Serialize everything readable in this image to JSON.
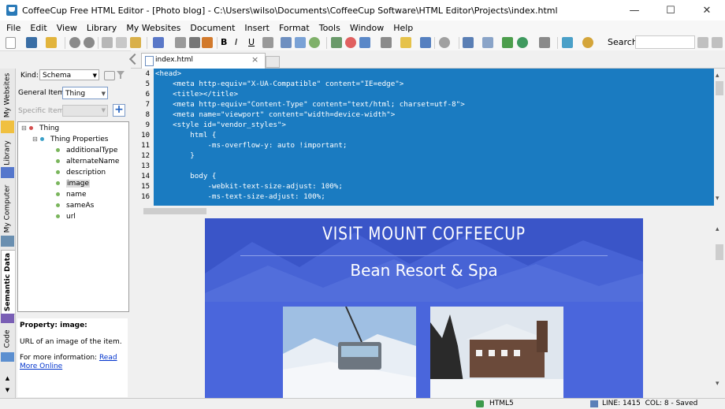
{
  "window": {
    "title": "CoffeeCup Free HTML Editor - [Photo blog] - C:\\Users\\wilso\\Documents\\CoffeeCup Software\\HTML Editor\\Projects\\index.html",
    "minimize": "—",
    "maximize": "☐",
    "close": "✕"
  },
  "menu": [
    "File",
    "Edit",
    "View",
    "Library",
    "My Websites",
    "Document",
    "Insert",
    "Format",
    "Tools",
    "Window",
    "Help"
  ],
  "toolbar": {
    "search_label": "Search:"
  },
  "sidebar_tabs": [
    "My Websites",
    "Library",
    "My Computer",
    "Semantic Data",
    "Code"
  ],
  "semantic": {
    "kind_label": "Kind:",
    "kind_value": "Schema",
    "general_label": "General Item:",
    "general_value": "Thing",
    "specific_label": "Specific Item:",
    "specific_value": "",
    "tree_root": "Thing",
    "tree_group": "Thing Properties",
    "properties": [
      "additionalType",
      "alternateName",
      "description",
      "image",
      "name",
      "sameAs",
      "url"
    ],
    "selected_property": "image",
    "desc_title": "Property: image:",
    "desc_body": "URL of an image of the item.",
    "desc_more": "For more information:",
    "desc_link": "Read More Online"
  },
  "editor": {
    "tab_label": "index.html",
    "tab_close": "×",
    "line_numbers": [
      "4",
      "5",
      "6",
      "7",
      "8",
      "9",
      "10",
      "11",
      "12",
      "13",
      "14",
      "15",
      "16"
    ],
    "lines": [
      "<head>",
      "    <meta http-equiv=\"X-UA-Compatible\" content=\"IE=edge\">",
      "    <title></title>",
      "    <meta http-equiv=\"Content-Type\" content=\"text/html; charset=utf-8\">",
      "    <meta name=\"viewport\" content=\"width=device-width\">",
      "    <style id=\"vendor_styles\">",
      "        html {",
      "            -ms-overflow-y: auto !important;",
      "        }",
      "",
      "        body {",
      "            -webkit-text-size-adjust: 100%;",
      "            -ms-text-size-adjust: 100%;"
    ]
  },
  "preview": {
    "heading": "VISIT MOUNT COFFEECUP",
    "subheading": "Bean Resort & Spa"
  },
  "status": {
    "doctype": "HTML5",
    "position": "LINE: 1415  COL: 8 - Saved"
  },
  "colors": {
    "code_bg": "#1a7bc1",
    "hero_bg": "#3f5bd6",
    "link": "#0033cc"
  }
}
